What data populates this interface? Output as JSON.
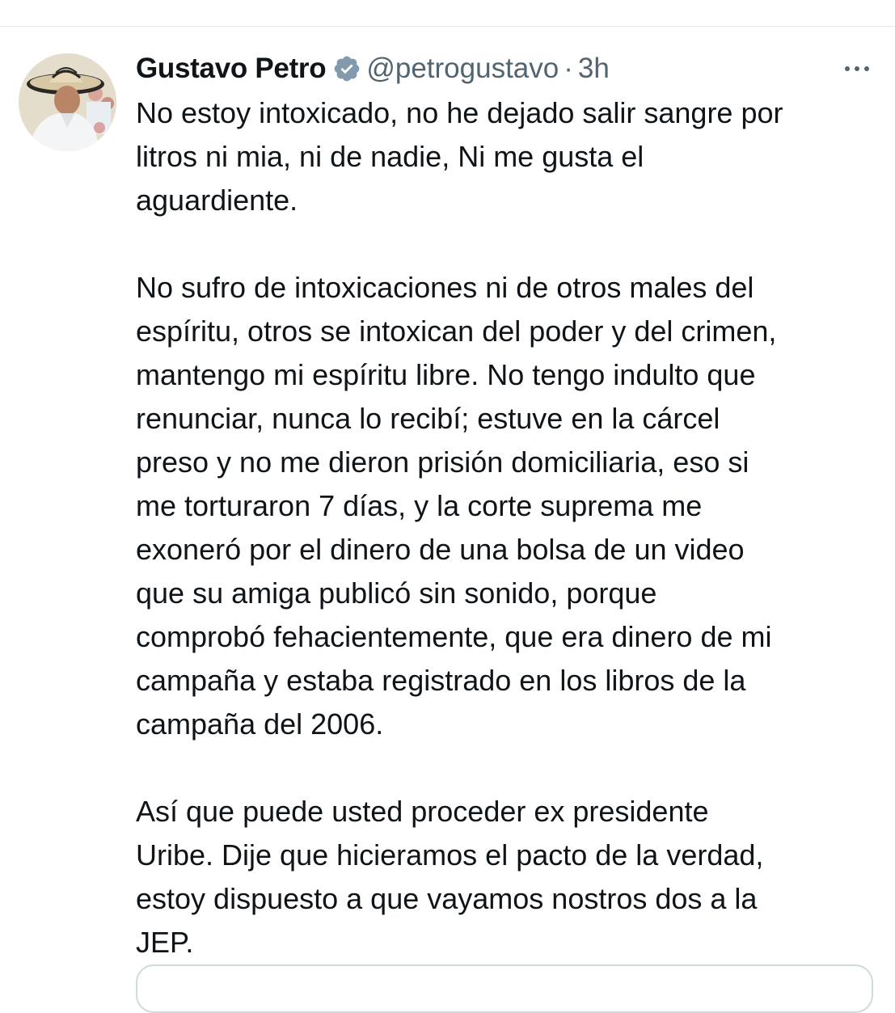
{
  "tweet": {
    "author": {
      "display_name": "Gustavo Petro",
      "handle": "@petrogustavo",
      "verified_icon": "verified-badge-icon",
      "avatar_icon": "profile-avatar"
    },
    "separator": "·",
    "time": "3h",
    "more_icon": "more-options-icon",
    "paragraphs": [
      "No estoy intoxicado, no he dejado salir sangre por\nlitros ni mia, ni de nadie, Ni me gusta el\naguardiente.",
      "No sufro de intoxicaciones ni de otros males del\nespíritu, otros se intoxican del poder y del crimen,\nmantengo mi espíritu libre. No tengo indulto que\nrenunciar, nunca lo recibí;  estuve en la cárcel\npreso y no me dieron prisión domiciliaria, eso si\nme torturaron 7 días, y la corte suprema me\nexoneró por el dinero de una bolsa de un video\nque su amiga publicó sin sonido, porque\ncomprobó fehacientemente, que era dinero de mi\ncampaña y estaba registrado en los libros de la\ncampaña del 2006.",
      "Así que puede usted proceder ex presidente\nUribe. Dije que hicieramos el pacto de la verdad,\nestoy dispuesto a que vayamos nostros dos a la\nJEP."
    ]
  },
  "colors": {
    "text_primary": "#0f1419",
    "text_secondary": "#536471",
    "verified_badge": "#829aab",
    "divider": "#e6e9eb"
  }
}
